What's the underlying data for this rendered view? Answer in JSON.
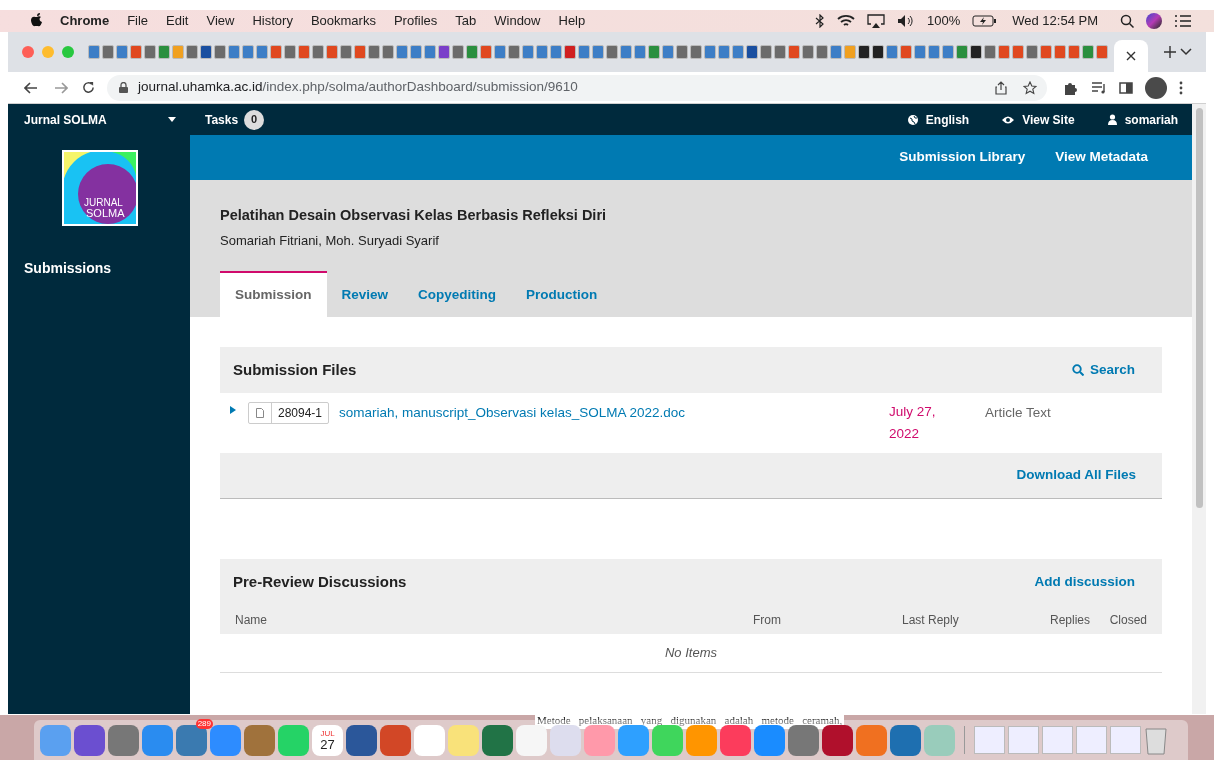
{
  "menu_bar": {
    "app": "Chrome",
    "items": [
      "File",
      "Edit",
      "View",
      "History",
      "Bookmarks",
      "Profiles",
      "Tab",
      "Window",
      "Help"
    ],
    "battery": "100%",
    "clock": "Wed 12:54 PM"
  },
  "browser": {
    "url_host": "journal.uhamka.ac.id",
    "url_path": "/index.php/solma/authorDashboard/submission/9610"
  },
  "header": {
    "journal": "Jurnal SOLMA",
    "tasks_label": "Tasks",
    "tasks_count": "0",
    "links": [
      {
        "kind": "globe",
        "label": "English"
      },
      {
        "kind": "eye",
        "label": "View Site"
      },
      {
        "kind": "user",
        "label": "somariah"
      }
    ]
  },
  "sidebar": {
    "logo_text_1": "JURNAL",
    "logo_text_2": "SOLMA",
    "items": [
      {
        "label": "Submissions"
      }
    ]
  },
  "context_links": [
    "Submission Library",
    "View Metadata"
  ],
  "submission": {
    "title": "Pelatihan Desain Observasi Kelas Berbasis Refleksi Diri",
    "authors": "Somariah Fitriani, Moh. Suryadi Syarif"
  },
  "tabs": [
    {
      "label": "Submission",
      "selected": true
    },
    {
      "label": "Review",
      "selected": false
    },
    {
      "label": "Copyediting",
      "selected": false
    },
    {
      "label": "Production",
      "selected": false
    }
  ],
  "files_panel": {
    "title": "Submission Files",
    "search": "Search",
    "files": [
      {
        "id": "28094-1",
        "name": "somariah, manuscript_Observasi kelas_SOLMA 2022.doc",
        "date": "July 27, 2022",
        "type": "Article Text"
      }
    ],
    "footer_action": "Download All Files"
  },
  "discussions_panel": {
    "title": "Pre-Review Discussions",
    "action": "Add discussion",
    "columns": [
      "Name",
      "From",
      "Last Reply",
      "Replies",
      "Closed"
    ],
    "empty": "No Items"
  },
  "background_document_text": "Metode   pelaksanaan   yang   digunakan   adalah   metode   ceramah,",
  "dock": {
    "mail_badge": "289",
    "calendar_month": "JUL",
    "calendar_day": "27"
  }
}
